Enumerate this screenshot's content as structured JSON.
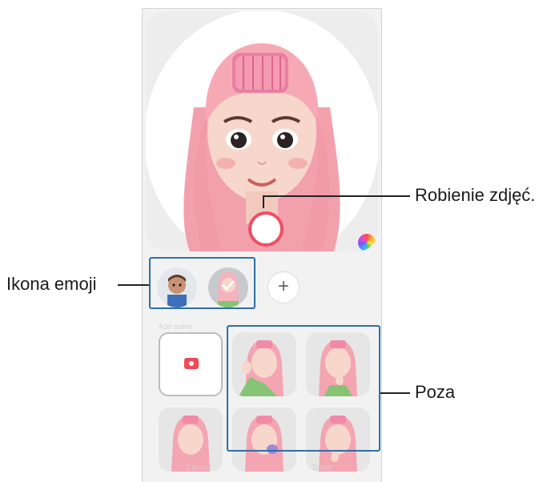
{
  "callouts": {
    "capture": "Robienie zdjęć.",
    "emoji_icon": "Ikona emoji",
    "pose": "Poza"
  },
  "emoji_panel": {
    "add_label": "+",
    "section_label": "Add scene"
  },
  "footer": {
    "cancel_label": "Cancel",
    "done_label": "Done"
  },
  "colors": {
    "accent_capture": "#ef4f63",
    "callout_box": "#2f6ea8",
    "hair": "#f6a9b5"
  }
}
